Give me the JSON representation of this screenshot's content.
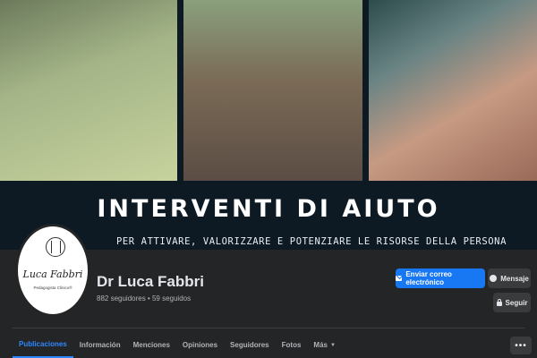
{
  "cover": {
    "title": "INTERVENTI DI AIUTO",
    "subtitle": "PER ATTIVARE, VALORIZZARE E POTENZIARE LE RISORSE DELLA PERSONA"
  },
  "profile": {
    "avatar_name": "Luca Fabbri",
    "avatar_tagline": "Pedagogista Clinico®",
    "name": "Dr Luca Fabbri",
    "stats": "882 seguidores • 59 seguidos"
  },
  "actions": {
    "email_label": "Enviar correo electrónico",
    "message_label": "Mensaje",
    "follow_label": "Seguir"
  },
  "tabs": [
    {
      "label": "Publicaciones"
    },
    {
      "label": "Información"
    },
    {
      "label": "Menciones"
    },
    {
      "label": "Opiniones"
    },
    {
      "label": "Seguidores"
    },
    {
      "label": "Fotos"
    },
    {
      "label": "Más"
    }
  ],
  "more_menu_label": "•••",
  "colors": {
    "accent": "#1877f2",
    "active_tab": "#2d88ff",
    "background": "#242526"
  }
}
